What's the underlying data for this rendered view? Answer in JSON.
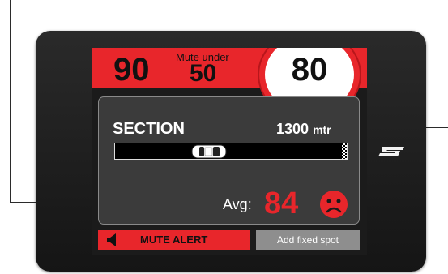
{
  "speed": {
    "current": "90",
    "mute_label": "Mute under",
    "mute_value": "50",
    "limit": "80"
  },
  "section": {
    "title": "SECTION",
    "distance_value": "1300",
    "distance_unit": "mtr",
    "progress": 0.39,
    "avg_label": "Avg:",
    "avg_value": "84",
    "mood_icon": "sad-face-icon"
  },
  "buttons": {
    "mute_alert": "MUTE ALERT",
    "add_fixed_spot": "Add fixed spot"
  },
  "colors": {
    "alert_red": "#e8262b",
    "panel_bg": "#3b3b3b",
    "device_bg": "#1b1b1b"
  }
}
